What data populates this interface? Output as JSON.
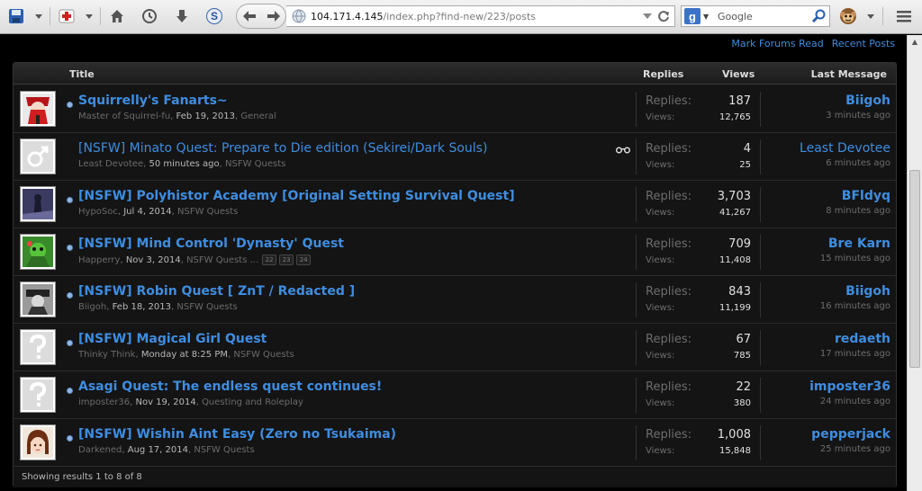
{
  "browser": {
    "url_host": "104.171.4.145",
    "url_path": "/index.php?find-new/223/posts",
    "search_engine_letter": "g",
    "search_placeholder": "Google",
    "s_button": "S"
  },
  "links": {
    "mark_forums_read": "Mark Forums Read",
    "recent_posts": "Recent Posts"
  },
  "columns": {
    "title": "Title",
    "replies": "Replies",
    "views": "Views",
    "last_message": "Last Message"
  },
  "labels": {
    "replies": "Replies:",
    "views": "Views:"
  },
  "threads": [
    {
      "title": "Squirrelly's Fanarts~",
      "author": "Master of Squirrel-fu",
      "date": "Feb 19, 2013",
      "forum": "General",
      "replies": "187",
      "views": "12,765",
      "last_user": "Biigoh",
      "last_time": "3 minutes ago",
      "unread": true
    },
    {
      "title": "[NSFW] Minato Quest: Prepare to Die edition (Sekirei/Dark Souls)",
      "author": "Least Devotee",
      "date": "50 minutes ago",
      "forum": "NSFW Quests",
      "replies": "4",
      "views": "25",
      "last_user": "Least Devotee",
      "last_time": "6 minutes ago",
      "unread": false
    },
    {
      "title": "[NSFW] Polyhistor Academy [Original Setting Survival Quest]",
      "author": "HypoSoc",
      "date": "Jul 4, 2014",
      "forum": "NSFW Quests",
      "replies": "3,703",
      "views": "41,267",
      "last_user": "BFldyq",
      "last_time": "8 minutes ago",
      "unread": true
    },
    {
      "title": "[NSFW] Mind Control 'Dynasty' Quest",
      "author": "Happerry",
      "date": "Nov 3, 2014",
      "forum": "NSFW Quests",
      "pages_ellipsis": "...",
      "pages": [
        "22",
        "23",
        "24"
      ],
      "replies": "709",
      "views": "11,408",
      "last_user": "Bre Karn",
      "last_time": "15 minutes ago",
      "unread": true
    },
    {
      "title": "[NSFW] Robin Quest [ ZnT / Redacted ]",
      "author": "Biigoh",
      "date": "Feb 18, 2013",
      "forum": "NSFW Quests",
      "replies": "843",
      "views": "11,199",
      "last_user": "Biigoh",
      "last_time": "16 minutes ago",
      "unread": true
    },
    {
      "title": "[NSFW] Magical Girl Quest",
      "author": "Thinky Think",
      "date": "Monday at 8:25 PM",
      "forum": "NSFW Quests",
      "replies": "67",
      "views": "785",
      "last_user": "redaeth",
      "last_time": "17 minutes ago",
      "unread": true
    },
    {
      "title": "Asagi Quest: The endless quest continues!",
      "author": "imposter36",
      "date": "Nov 19, 2014",
      "forum": "Questing and Roleplay",
      "replies": "22",
      "views": "380",
      "last_user": "imposter36",
      "last_time": "24 minutes ago",
      "unread": true
    },
    {
      "title": "[NSFW] Wishin Aint Easy (Zero no Tsukaima)",
      "author": "Darkened",
      "date": "Aug 17, 2014",
      "forum": "NSFW Quests",
      "replies": "1,008",
      "views": "15,848",
      "last_user": "pepperjack",
      "last_time": "25 minutes ago",
      "unread": true
    }
  ],
  "footer": {
    "text": "Showing results 1 to 8 of 8"
  }
}
